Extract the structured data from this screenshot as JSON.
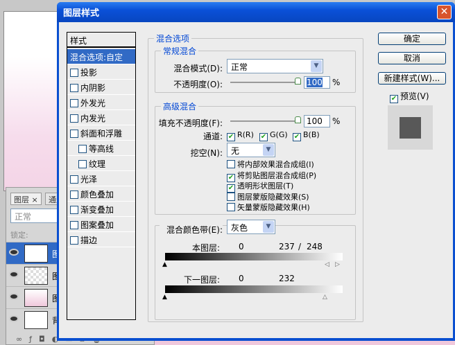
{
  "layers_panel": {
    "tabs": [
      "图层",
      "通道"
    ],
    "blend_mode": "正常",
    "lock_label": "锁定:",
    "layer_names": [
      "图",
      "图",
      "图",
      "背"
    ]
  },
  "dialog": {
    "title": "图层样式",
    "styles_header": "样式",
    "styles": [
      {
        "label": "混合选项:自定",
        "selected": true
      },
      {
        "label": "投影",
        "checked": false
      },
      {
        "label": "内阴影",
        "checked": false
      },
      {
        "label": "外发光",
        "checked": false
      },
      {
        "label": "内发光",
        "checked": false
      },
      {
        "label": "斜面和浮雕",
        "checked": false
      },
      {
        "label": "等高线",
        "checked": false,
        "indent": true
      },
      {
        "label": "纹理",
        "checked": false,
        "indent": true
      },
      {
        "label": "光泽",
        "checked": false
      },
      {
        "label": "颜色叠加",
        "checked": false
      },
      {
        "label": "渐变叠加",
        "checked": false
      },
      {
        "label": "图案叠加",
        "checked": false
      },
      {
        "label": "描边",
        "checked": false
      }
    ],
    "blending_options": "混合选项",
    "general": {
      "legend": "常规混合",
      "mode_label": "混合模式(D):",
      "mode": "正常",
      "opacity_label": "不透明度(O):",
      "opacity": "100",
      "pct": "%"
    },
    "advanced": {
      "legend": "高级混合",
      "fill_label": "填充不透明度(F):",
      "fill": "100",
      "pct": "%",
      "channels_label": "通道:",
      "channels": [
        {
          "label": "R(R)",
          "checked": true
        },
        {
          "label": "G(G)",
          "checked": true
        },
        {
          "label": "B(B)",
          "checked": true
        }
      ],
      "knockout_label": "挖空(N):",
      "knockout": "无",
      "options": [
        {
          "label": "将内部效果混合成组(I)",
          "checked": false
        },
        {
          "label": "将剪贴图层混合成组(P)",
          "checked": true
        },
        {
          "label": "透明形状图层(T)",
          "checked": true
        },
        {
          "label": "图层蒙版隐藏效果(S)",
          "checked": false
        },
        {
          "label": "矢量蒙版隐藏效果(H)",
          "checked": false
        }
      ]
    },
    "blend_if": {
      "label": "混合颜色带(E):",
      "value": "灰色",
      "this_layer": "本图层:",
      "this_low": "0",
      "this_high_a": "237",
      "sep": "/",
      "this_high_b": "248",
      "under_layer": "下一图层:",
      "under_low": "0",
      "under_high": "232"
    },
    "buttons": {
      "ok": "确定",
      "cancel": "取消",
      "new_style": "新建样式(W)...",
      "preview": "预览(V)",
      "preview_checked": true
    }
  }
}
